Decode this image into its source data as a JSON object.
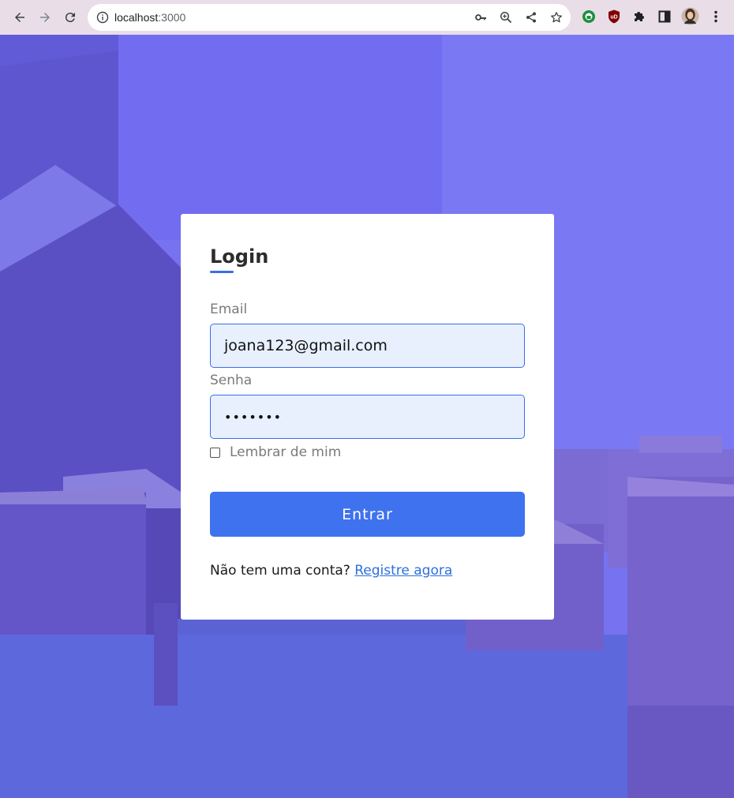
{
  "browser": {
    "url_host": "localhost",
    "url_port": ":3000",
    "icons": {
      "back": "back-arrow-icon",
      "forward": "forward-arrow-icon",
      "reload": "reload-icon",
      "site_info": "info-icon",
      "password_key": "key-icon",
      "zoom": "zoom-icon",
      "share": "share-icon",
      "bookmark": "star-icon",
      "extension_green": "green-extension-icon",
      "ublock": "ublock-icon",
      "extensions": "puzzle-icon",
      "side_panel": "side-panel-icon",
      "profile": "avatar",
      "menu": "kebab-menu-icon"
    },
    "ublock_badge": "uD"
  },
  "login": {
    "title": "Login",
    "email_label": "Email",
    "email_value": "joana123@gmail.com",
    "password_label": "Senha",
    "password_value": "•••••••",
    "remember_label": "Lembrar de mim",
    "submit_label": "Entrar",
    "signup_prompt": "Não tem uma conta?",
    "signup_link": "Registre agora"
  },
  "colors": {
    "accent": "#3f72ef",
    "background_tint": "#6b63e6",
    "link": "#2d6fe0",
    "field_bg": "#e8f0fe"
  }
}
